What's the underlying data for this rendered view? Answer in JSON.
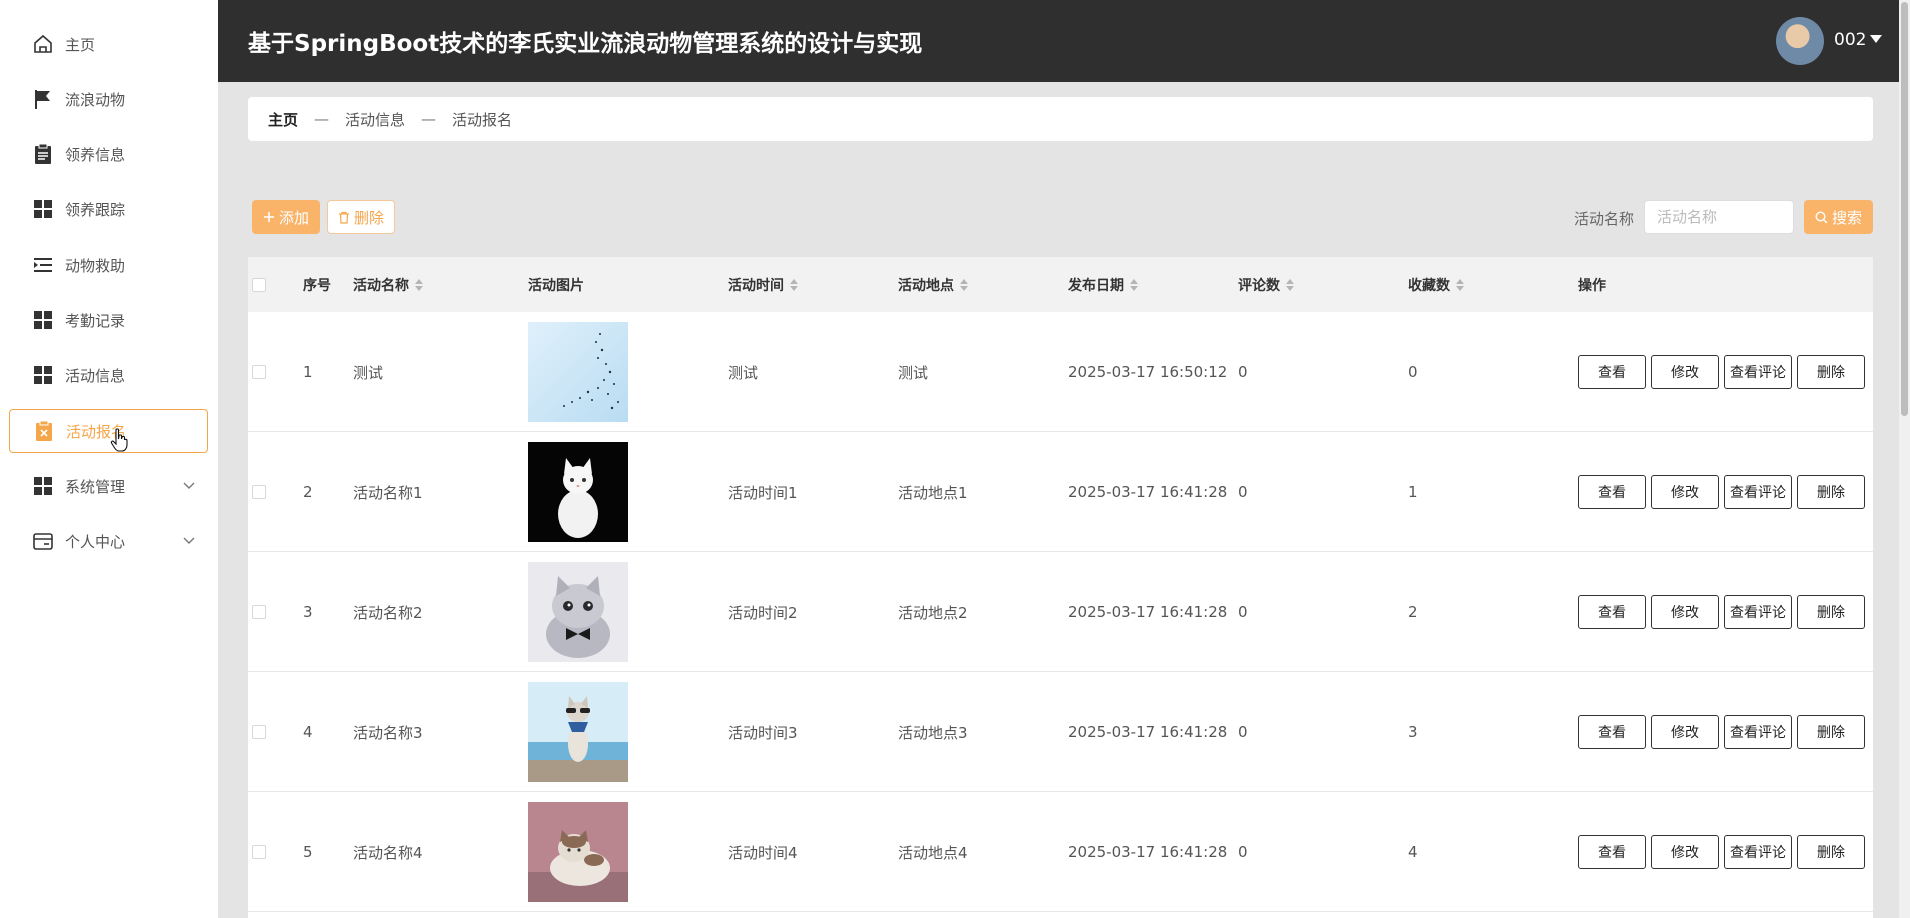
{
  "app": {
    "title": "基于SpringBoot技术的李氏实业流浪动物管理系统的设计与实现",
    "user": "002"
  },
  "sidebar": {
    "items": [
      {
        "label": "主页",
        "icon": "home-icon"
      },
      {
        "label": "流浪动物",
        "icon": "flag-icon"
      },
      {
        "label": "领养信息",
        "icon": "clipboard-icon"
      },
      {
        "label": "领养跟踪",
        "icon": "grid-icon"
      },
      {
        "label": "动物救助",
        "icon": "menu-indent-icon"
      },
      {
        "label": "考勤记录",
        "icon": "grid-icon"
      },
      {
        "label": "活动信息",
        "icon": "grid-icon"
      },
      {
        "label": "活动报名",
        "icon": "clipboard-x-icon"
      },
      {
        "label": "系统管理",
        "icon": "grid-icon"
      },
      {
        "label": "个人中心",
        "icon": "wallet-icon"
      }
    ]
  },
  "breadcrumb": {
    "home": "主页",
    "sep": "—",
    "level1": "活动信息",
    "level2": "活动报名"
  },
  "toolbar": {
    "add_label": "添加",
    "delete_label": "删除",
    "search_label": "活动名称",
    "search_placeholder": "活动名称",
    "search_button": "搜索"
  },
  "table": {
    "columns": [
      "序号",
      "活动名称",
      "活动图片",
      "活动时间",
      "活动地点",
      "发布日期",
      "评论数",
      "收藏数",
      "操作"
    ],
    "actions": [
      "查看",
      "修改",
      "查看评论",
      "删除"
    ],
    "rows": [
      {
        "index": "1",
        "name": "测试",
        "image": "sky-birds-image",
        "time": "测试",
        "place": "测试",
        "date": "2025-03-17 16:50:12",
        "comments": "0",
        "favorites": "0"
      },
      {
        "index": "2",
        "name": "活动名称1",
        "image": "white-cat-image",
        "time": "活动时间1",
        "place": "活动地点1",
        "date": "2025-03-17 16:41:28",
        "comments": "0",
        "favorites": "1"
      },
      {
        "index": "3",
        "name": "活动名称2",
        "image": "gray-kitten-image",
        "time": "活动时间2",
        "place": "活动地点2",
        "date": "2025-03-17 16:41:28",
        "comments": "0",
        "favorites": "2"
      },
      {
        "index": "4",
        "name": "活动名称3",
        "image": "seaside-cat-image",
        "time": "活动时间3",
        "place": "活动地点3",
        "date": "2025-03-17 16:41:28",
        "comments": "0",
        "favorites": "3"
      },
      {
        "index": "5",
        "name": "活动名称4",
        "image": "calico-cat-image",
        "time": "活动时间4",
        "place": "活动地点4",
        "date": "2025-03-17 16:41:28",
        "comments": "0",
        "favorites": "4"
      }
    ]
  },
  "colors": {
    "accent": "#f9b46a",
    "header_bg": "#2f2f2f",
    "active_border": "#f5a64b"
  }
}
